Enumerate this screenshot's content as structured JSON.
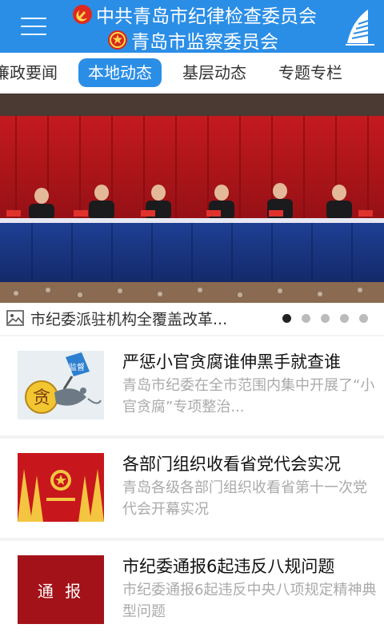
{
  "header": {
    "title_line1": "中共青岛市纪律检查委员会",
    "title_line2": "青岛市监察委员会",
    "menu_icon": "hamburger-menu-icon",
    "right_icon": "sail-logo-icon",
    "bg_color": "#2b8ee6"
  },
  "tabs": [
    {
      "label": "廉政要闻",
      "active": false
    },
    {
      "label": "本地动态",
      "active": true
    },
    {
      "label": "基层动态",
      "active": false
    },
    {
      "label": "专题专栏",
      "active": false
    }
  ],
  "banner": {
    "caption": "市纪委派驻机构全覆盖改革...",
    "caption_icon": "image-icon",
    "slide_count": 5,
    "active_slide": 1
  },
  "news": [
    {
      "title": "严惩小官贪腐谁伸黑手就查谁",
      "desc": "青岛市纪委在全市范围内集中开展了“小官贪腐”专项整治...",
      "thumb_text": "贪",
      "thumb_sign": "监督"
    },
    {
      "title": "各部门组织收看省党代会实况",
      "desc": "青岛各级各部门组织收看省第十一次党代会开幕实况"
    },
    {
      "title": "市纪委通报6起违反八规问题",
      "desc": "市纪委通报6起违反中央八项规定精神典型问题",
      "thumb_text": "通 报"
    }
  ]
}
